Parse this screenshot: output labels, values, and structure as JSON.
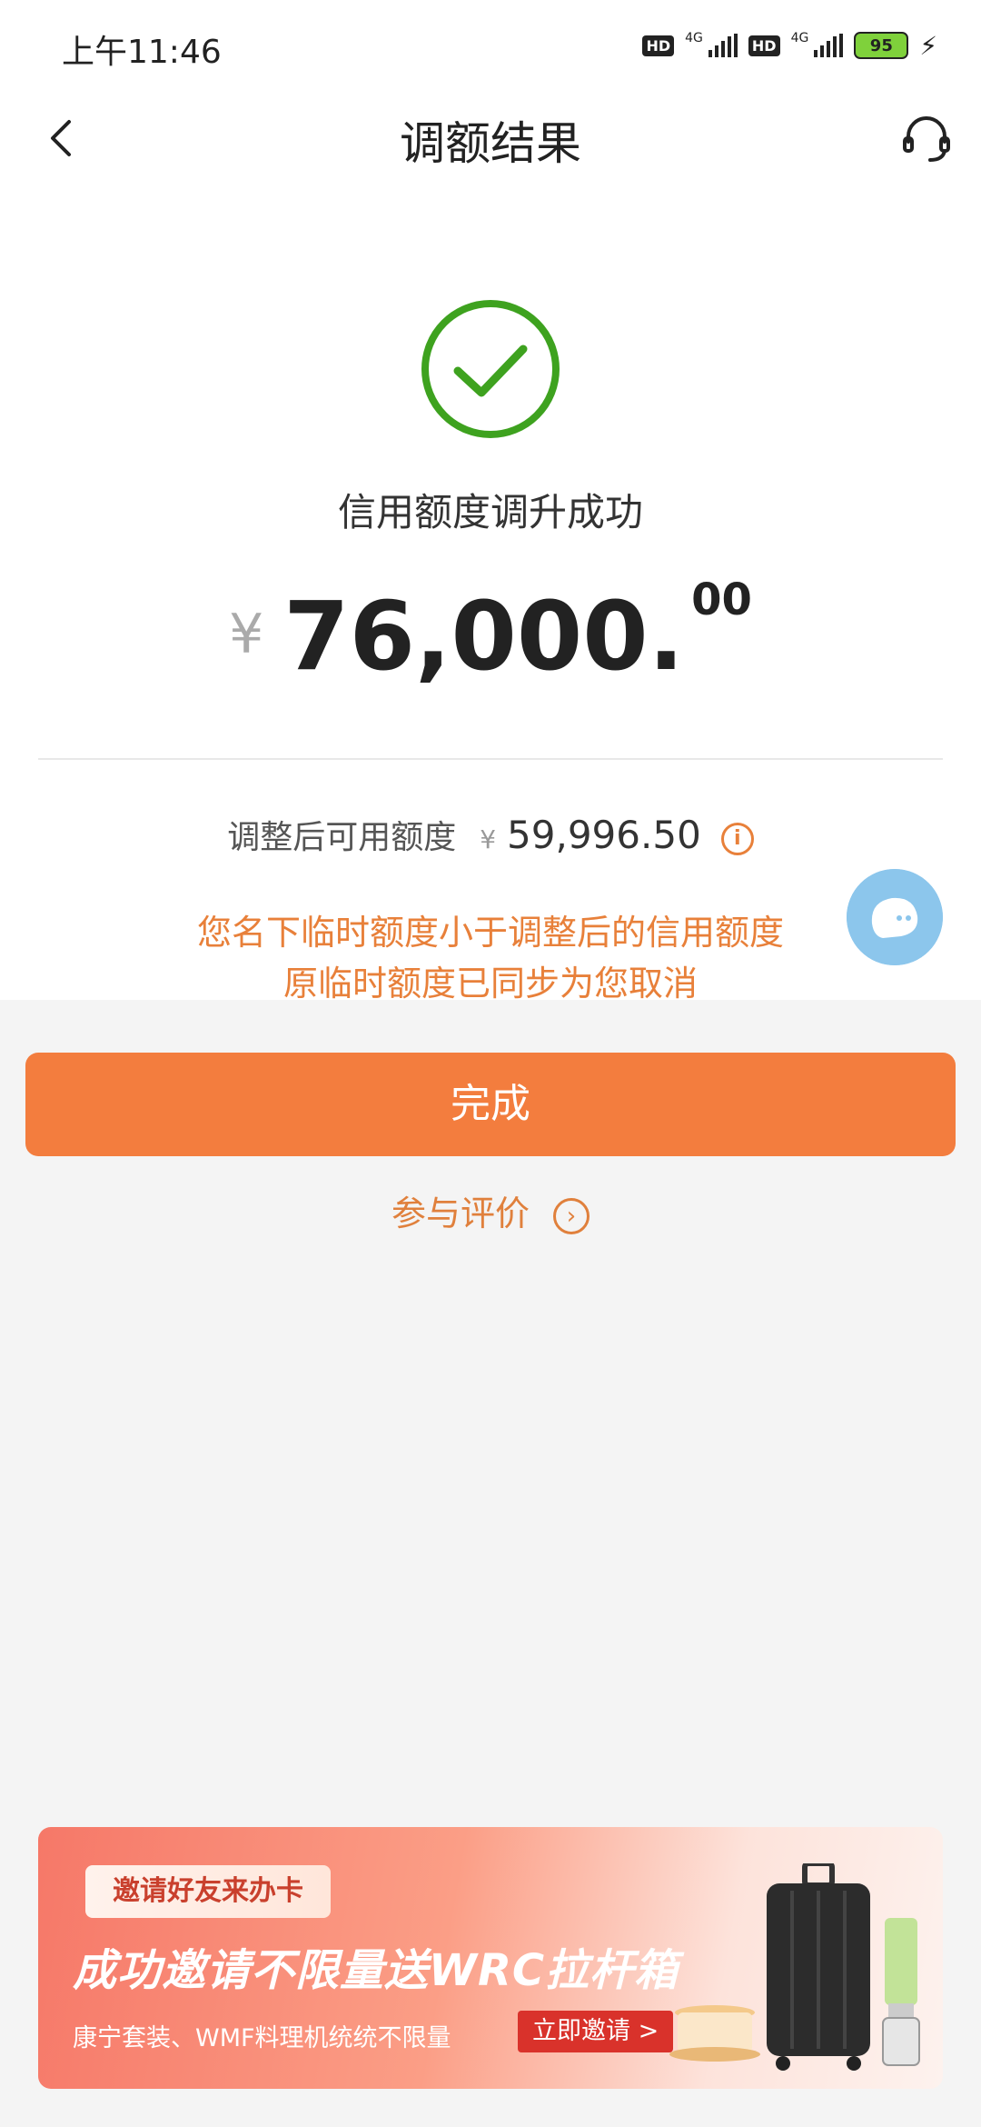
{
  "status_bar": {
    "time": "上午11:46",
    "sim1_hd": "HD",
    "sim1_net": "4G",
    "sim2_hd": "HD",
    "sim2_net": "4G",
    "battery": "95"
  },
  "header": {
    "title": "调额结果",
    "back_icon": "chevron-left-icon",
    "support_icon": "headset-icon"
  },
  "result": {
    "icon": "check-circle-icon",
    "status_text": "信用额度调升成功",
    "currency_symbol": "¥",
    "amount_integer": "76,000.",
    "amount_decimal": "00",
    "available_label": "调整后可用额度",
    "available_currency": "¥",
    "available_value": "59,996.50",
    "info_icon_glyph": "i",
    "notice_line1": "您名下临时额度小于调整后的信用额度",
    "notice_line2": "原临时额度已同步为您取消"
  },
  "actions": {
    "done_label": "完成",
    "rate_label": "参与评价",
    "rate_arrow": "›"
  },
  "banner": {
    "tag": "邀请好友来办卡",
    "headline": "成功邀请不限量送WRC拉杆箱",
    "sub": "康宁套装、WMF料理机统统不限量",
    "cta": "立即邀请 >"
  },
  "colors": {
    "accent": "#f37d3e",
    "success": "#3ea21f",
    "notice": "#e8803a",
    "chat": "#8cc6ec"
  }
}
